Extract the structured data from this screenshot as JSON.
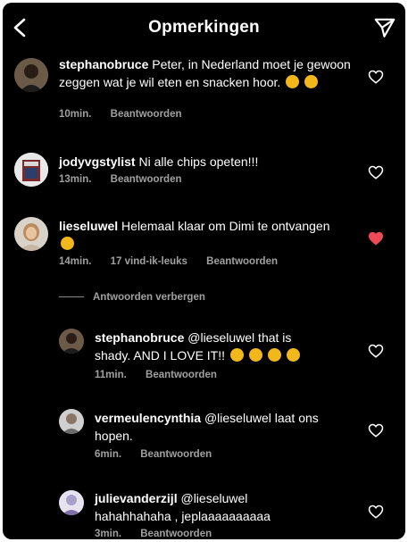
{
  "header": {
    "title": "Opmerkingen",
    "back_icon": "chevron-left-icon",
    "send_icon": "send-icon"
  },
  "colors": {
    "background": "#000000",
    "text": "#ffffff",
    "secondary_text": "#a0a0a0",
    "liked_heart": "#ed4956"
  },
  "comments": [
    {
      "username": "stephanobruce",
      "text": "Peter, in Nederland moet je gewoon zeggen wat je wil eten en snacken hoor.",
      "emojis": [
        "smiling-face-with-hand-over-mouth",
        "smiling-face-with-hand-over-mouth"
      ],
      "time": "10min.",
      "reply": "Beantwoorden",
      "liked": false
    },
    {
      "username": "jodyvgstylist",
      "text": "Ni alle chips opeten!!!",
      "time": "13min.",
      "reply": "Beantwoorden",
      "liked": false
    },
    {
      "username": "lieseluwel",
      "text": "Helemaal klaar om Dimi te ontvangen",
      "emojis": [
        "relieved-face"
      ],
      "time": "14min.",
      "likes": "17 vind-ik-leuks",
      "reply": "Beantwoorden",
      "liked": true
    }
  ],
  "hide_replies": "Antwoorden verbergen",
  "replies": [
    {
      "username": "stephanobruce",
      "text": "@lieseluwel that is shady. AND I LOVE IT!!",
      "emojis": [
        "face-with-tears-of-joy",
        "face-with-tears-of-joy",
        "face-with-tears-of-joy",
        "face-with-tears-of-joy"
      ],
      "time": "11min.",
      "reply": "Beantwoorden",
      "liked": false
    },
    {
      "username": "vermeulencynthia",
      "text": "@lieseluwel laat ons hopen.",
      "time": "6min.",
      "reply": "Beantwoorden",
      "liked": false
    },
    {
      "username": "julievanderzijl",
      "text": "@lieseluwel hahahhahaha , jeplaaaaaaaaaa",
      "time": "3min.",
      "reply": "Beantwoorden",
      "liked": false
    }
  ]
}
